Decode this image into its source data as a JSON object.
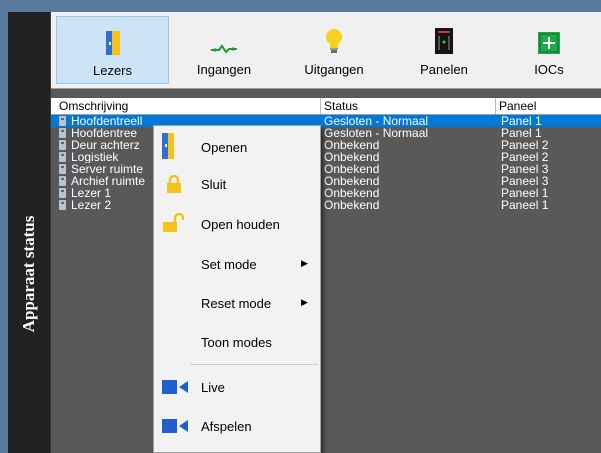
{
  "sidebar": {
    "title": "Apparaat status"
  },
  "tabs": [
    {
      "label": "Lezers",
      "icon": "door-icon",
      "active": true
    },
    {
      "label": "Ingangen",
      "icon": "input-wire-icon",
      "active": false
    },
    {
      "label": "Uitgangen",
      "icon": "light-bulb-icon",
      "active": false
    },
    {
      "label": "Panelen",
      "icon": "panel-icon",
      "active": false
    },
    {
      "label": "IOCs",
      "icon": "io-module-icon",
      "active": false
    }
  ],
  "table": {
    "columns": [
      "Omschrijving",
      "Status",
      "Paneel"
    ],
    "rows": [
      {
        "name": "Hoofdentreell",
        "status": "Gesloten - Normaal",
        "panel": "Panel 1",
        "selected": true
      },
      {
        "name": "Hoofdentree",
        "status": "Gesloten - Normaal",
        "panel": "Panel 1",
        "selected": false
      },
      {
        "name": "Deur achterz",
        "status": "Onbekend",
        "panel": "Paneel 2",
        "selected": false
      },
      {
        "name": "Logistiek",
        "status": "Onbekend",
        "panel": "Paneel 2",
        "selected": false
      },
      {
        "name": "Server ruimte",
        "status": "Onbekend",
        "panel": "Paneel 3",
        "selected": false
      },
      {
        "name": "Archief ruimte",
        "status": "Onbekend",
        "panel": "Paneel 3",
        "selected": false
      },
      {
        "name": "Lezer 1",
        "status": "Onbekend",
        "panel": "Paneel 1",
        "selected": false
      },
      {
        "name": "Lezer 2",
        "status": "Onbekend",
        "panel": "Paneel 1",
        "selected": false
      }
    ]
  },
  "context_menu": {
    "items": [
      {
        "label": "Openen",
        "icon": "door-open-icon"
      },
      {
        "label": "Sluit",
        "icon": "lock-closed-icon"
      },
      {
        "label": "Open houden",
        "icon": "lock-open-icon"
      },
      {
        "label": "Set mode",
        "submenu": true
      },
      {
        "label": "Reset mode",
        "submenu": true
      },
      {
        "label": "Toon modes"
      },
      {
        "label": "Live",
        "icon": "video-camera-icon"
      },
      {
        "label": "Afspelen",
        "icon": "video-camera-icon"
      }
    ]
  },
  "colors": {
    "accent": "#0078d7",
    "frame": "#59799a",
    "sidebar": "#222222",
    "list_bg": "#595959"
  }
}
